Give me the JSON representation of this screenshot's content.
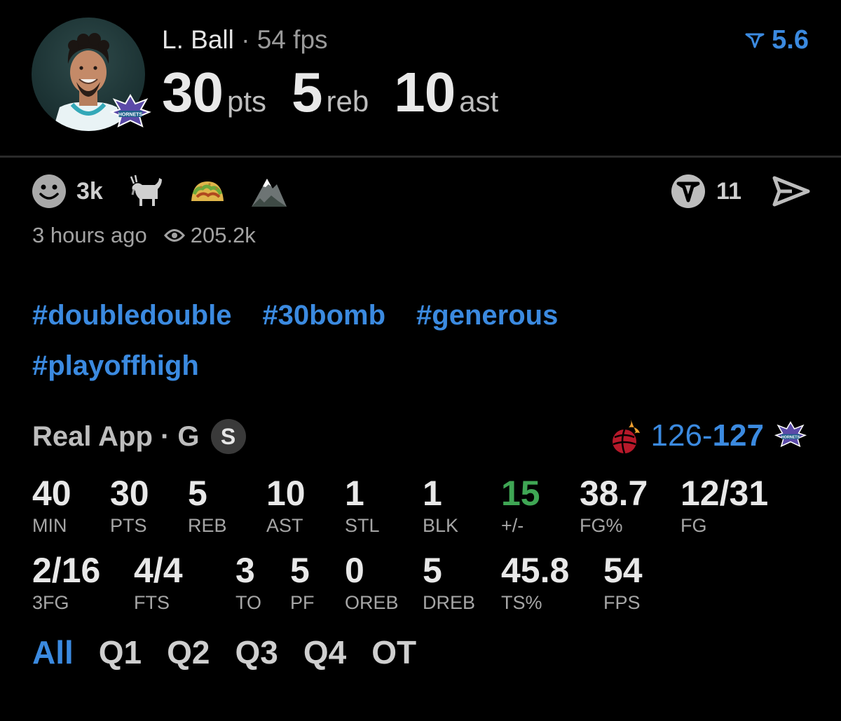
{
  "player": {
    "name": "L. Ball",
    "separator": "·",
    "fps_label": "54 fps",
    "statline": [
      {
        "value": "30",
        "unit": "pts"
      },
      {
        "value": "5",
        "unit": "reb"
      },
      {
        "value": "10",
        "unit": "ast"
      }
    ],
    "rating": "5.6",
    "team_logo_text": "HORNETS"
  },
  "reactions": {
    "emoji_count": "3k",
    "comment_count": "11"
  },
  "meta": {
    "time_ago": "3 hours ago",
    "views": "205.2k"
  },
  "hashtags": [
    "#doubledouble",
    "#30bomb",
    "#generous",
    "#playoffhigh"
  ],
  "game": {
    "source": "Real App · G",
    "badge": "S",
    "score_away": "126",
    "score_dash": "-",
    "score_home": "127",
    "home_logo_text": "HORNETS"
  },
  "stats_row1": [
    {
      "value": "40",
      "label": "MIN"
    },
    {
      "value": "30",
      "label": "PTS"
    },
    {
      "value": "5",
      "label": "REB"
    },
    {
      "value": "10",
      "label": "AST"
    },
    {
      "value": "1",
      "label": "STL"
    },
    {
      "value": "1",
      "label": "BLK"
    },
    {
      "value": "15",
      "label": "+/-"
    },
    {
      "value": "38.7",
      "label": "FG%"
    },
    {
      "value": "12/31",
      "label": "FG"
    }
  ],
  "stats_row2": [
    {
      "value": "2/16",
      "label": "3FG"
    },
    {
      "value": "4/4",
      "label": "FTS"
    },
    {
      "value": "3",
      "label": "TO"
    },
    {
      "value": "5",
      "label": "PF"
    },
    {
      "value": "0",
      "label": "OREB"
    },
    {
      "value": "5",
      "label": "DREB"
    },
    {
      "value": "45.8",
      "label": "TS%"
    },
    {
      "value": "54",
      "label": "FPS"
    }
  ],
  "periods": [
    "All",
    "Q1",
    "Q2",
    "Q3",
    "Q4",
    "OT"
  ],
  "colors": {
    "accent": "#3b8ae0",
    "positive": "#3fa654",
    "background": "#000000"
  }
}
